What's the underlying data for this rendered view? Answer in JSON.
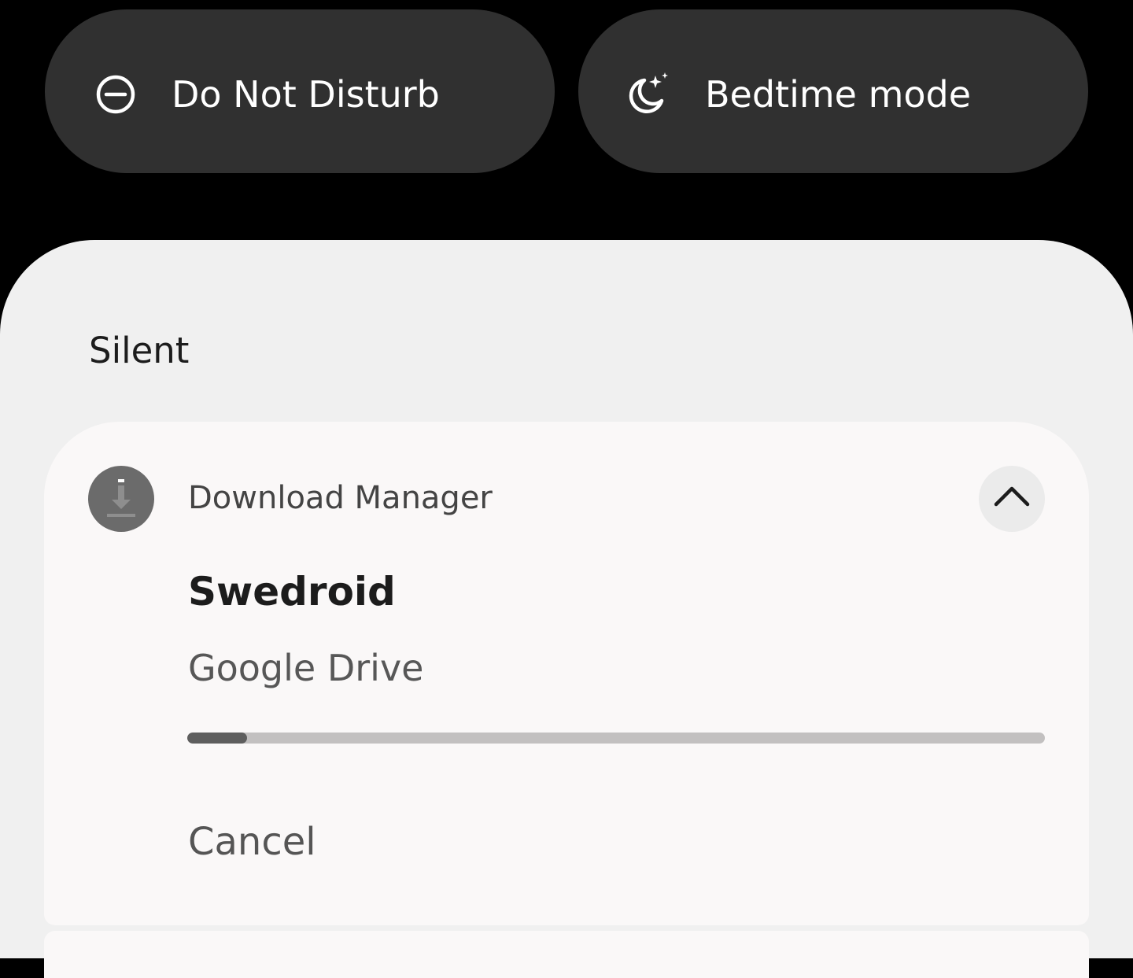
{
  "quick_settings": {
    "tiles": [
      {
        "label": "Do Not Disturb",
        "icon": "do-not-disturb-icon"
      },
      {
        "label": "Bedtime mode",
        "icon": "bedtime-moon-stars-icon"
      }
    ]
  },
  "notifications": {
    "section_header": "Silent",
    "download": {
      "app_name": "Download Manager",
      "app_icon": "download-arrow-icon",
      "expand_icon": "chevron-up-icon",
      "title": "Swedroid",
      "text": "Google Drive",
      "progress_fraction": 0.07,
      "action_cancel": "Cancel"
    }
  },
  "colors": {
    "background": "#000000",
    "tile_background": "#303030",
    "shade_background": "#f0f0f0",
    "card_background": "#faf8f8",
    "progress_track": "#c2c0c0",
    "progress_fill": "#5e5e5e"
  }
}
